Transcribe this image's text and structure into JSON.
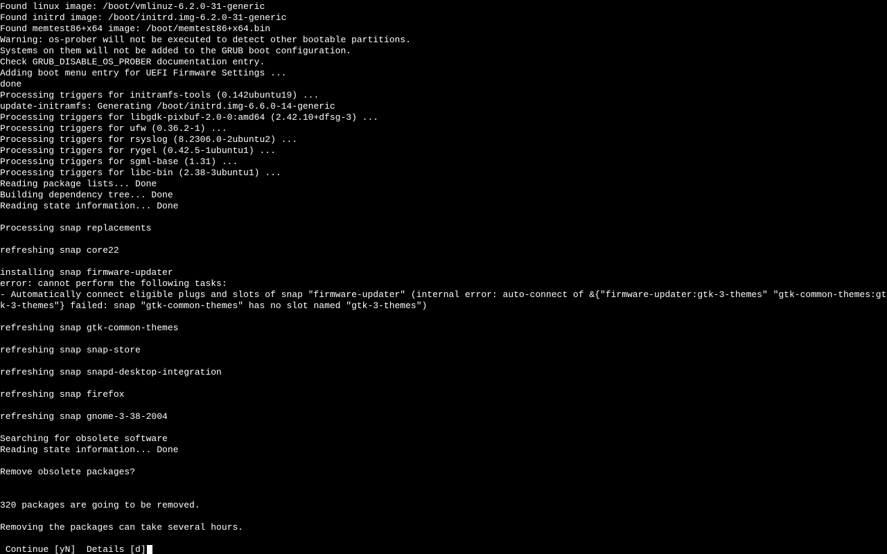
{
  "terminal": {
    "lines": [
      "Found linux image: /boot/vmlinuz-6.2.0-31-generic",
      "Found initrd image: /boot/initrd.img-6.2.0-31-generic",
      "Found memtest86+x64 image: /boot/memtest86+x64.bin",
      "Warning: os-prober will not be executed to detect other bootable partitions.",
      "Systems on them will not be added to the GRUB boot configuration.",
      "Check GRUB_DISABLE_OS_PROBER documentation entry.",
      "Adding boot menu entry for UEFI Firmware Settings ...",
      "done",
      "Processing triggers for initramfs-tools (0.142ubuntu19) ...",
      "update-initramfs: Generating /boot/initrd.img-6.6.0-14-generic",
      "Processing triggers for libgdk-pixbuf-2.0-0:amd64 (2.42.10+dfsg-3) ...",
      "Processing triggers for ufw (0.36.2-1) ...",
      "Processing triggers for rsyslog (8.2306.0-2ubuntu2) ...",
      "Processing triggers for rygel (0.42.5-1ubuntu1) ...",
      "Processing triggers for sgml-base (1.31) ...",
      "Processing triggers for libc-bin (2.38-3ubuntu1) ...",
      "Reading package lists... Done",
      "Building dependency tree... Done",
      "Reading state information... Done",
      "",
      "Processing snap replacements",
      "",
      "refreshing snap core22",
      "",
      "installing snap firmware-updater",
      "error: cannot perform the following tasks:",
      "- Automatically connect eligible plugs and slots of snap \"firmware-updater\" (internal error: auto-connect of &{\"firmware-updater:gtk-3-themes\" \"gtk-common-themes:gtk-3-themes\"} failed: snap \"gtk-common-themes\" has no slot named \"gtk-3-themes\")",
      "",
      "refreshing snap gtk-common-themes",
      "",
      "refreshing snap snap-store",
      "",
      "refreshing snap snapd-desktop-integration",
      "",
      "refreshing snap firefox",
      "",
      "refreshing snap gnome-3-38-2004",
      "",
      "Searching for obsolete software",
      "Reading state information... Done",
      "",
      "Remove obsolete packages?",
      "",
      "",
      "320 packages are going to be removed.",
      "",
      "Removing the packages can take several hours.",
      ""
    ],
    "prompt": " Continue [yN]  Details [d]"
  }
}
